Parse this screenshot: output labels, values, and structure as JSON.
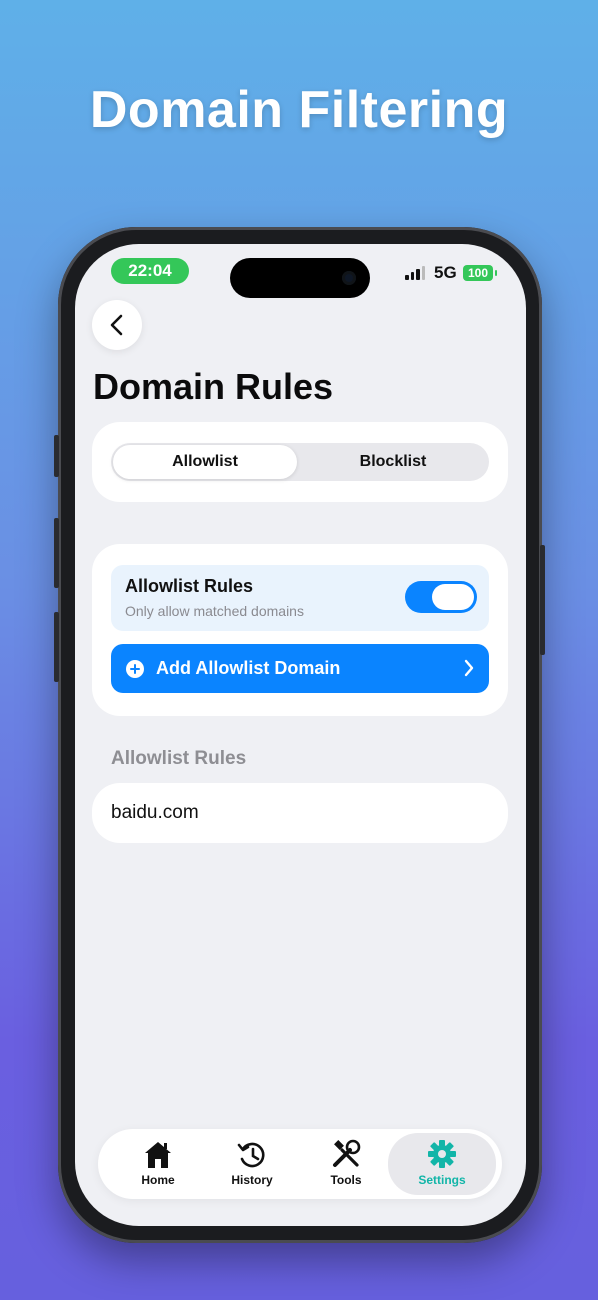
{
  "headline": "Domain Filtering",
  "status_bar": {
    "time": "22:04",
    "network": "5G",
    "battery": "100"
  },
  "page": {
    "title": "Domain Rules"
  },
  "segmented": {
    "options": [
      "Allowlist",
      "Blocklist"
    ],
    "selected": "Allowlist"
  },
  "rules_card": {
    "toggle_title": "Allowlist Rules",
    "toggle_subtitle": "Only allow matched domains",
    "toggle_on": true,
    "add_button_label": "Add Allowlist Domain"
  },
  "list": {
    "section_label": "Allowlist Rules",
    "items": [
      "baidu.com"
    ]
  },
  "tabbar": {
    "items": [
      {
        "label": "Home",
        "icon": "home-icon"
      },
      {
        "label": "History",
        "icon": "history-icon"
      },
      {
        "label": "Tools",
        "icon": "tools-icon"
      },
      {
        "label": "Settings",
        "icon": "settings-icon"
      }
    ],
    "active": "Settings"
  },
  "colors": {
    "accent": "#0a84ff",
    "active_tab": "#12b5a8",
    "status_green": "#34c759"
  }
}
